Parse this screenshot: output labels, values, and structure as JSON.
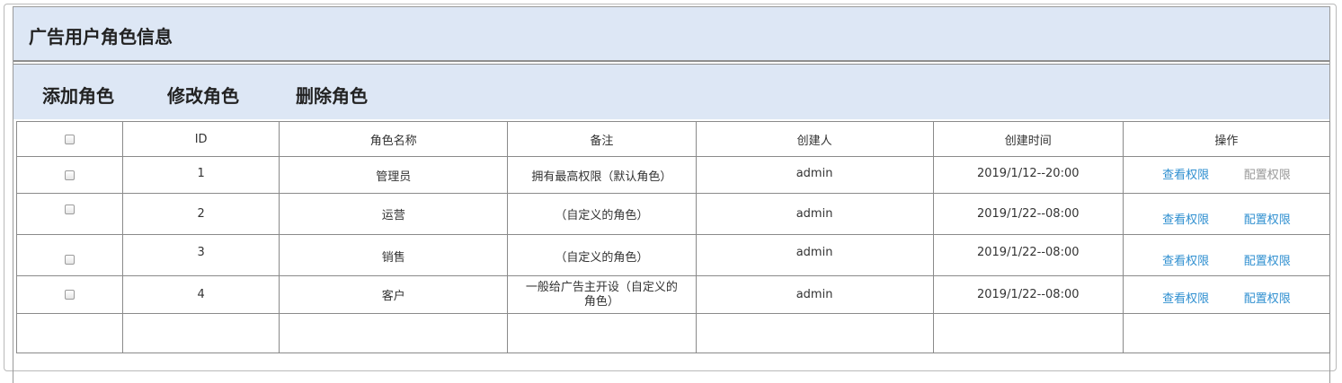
{
  "page": {
    "title": "广告用户角色信息"
  },
  "toolbar": {
    "add_label": "添加角色",
    "edit_label": "修改角色",
    "delete_label": "删除角色"
  },
  "table": {
    "headers": [
      "ID",
      "角色名称",
      "备注",
      "创建人",
      "创建时间",
      "操作"
    ],
    "rows": [
      {
        "id": "1",
        "name": "管理员",
        "note": "拥有最高权限（默认角色）",
        "creator": "admin",
        "time": "2019/1/12--20:00",
        "view": "查看权限",
        "config": "配置权限"
      },
      {
        "id": "2",
        "name": "运营",
        "note": "（自定义的角色）",
        "creator": "admin",
        "time": "2019/1/22--08:00",
        "view": "查看权限",
        "config": "配置权限"
      },
      {
        "id": "3",
        "name": "销售",
        "note": "（自定义的角色）",
        "creator": "admin",
        "time": "2019/1/22--08:00",
        "view": "查看权限",
        "config": "配置权限"
      },
      {
        "id": "4",
        "name": "客户",
        "note": "一般给广告主开设（自定义的角色）",
        "creator": "admin",
        "time": "2019/1/22--08:00",
        "view": "查看权限",
        "config": "配置权限"
      }
    ]
  },
  "colors": {
    "header_bg": "#dde7f5",
    "link": "#2f8fd0",
    "link_disabled": "#999999"
  }
}
